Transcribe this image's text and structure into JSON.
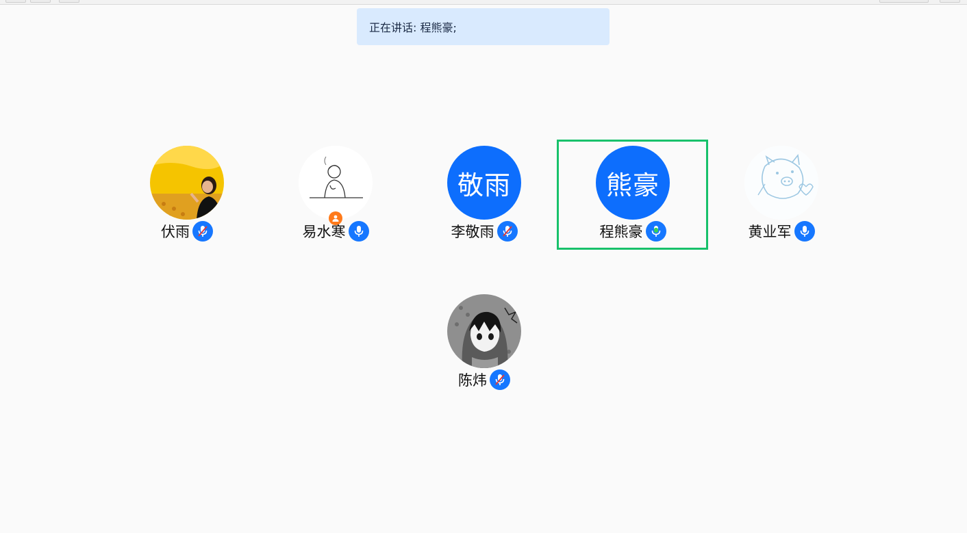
{
  "banner": {
    "label": "正在讲话:",
    "speaker": "程熊豪;"
  },
  "participants": [
    {
      "name": "伏雨",
      "avatar": "photo-yellow",
      "mic": "muted"
    },
    {
      "name": "易水寒",
      "avatar": "sketch-person",
      "mic": "on",
      "badge": "host-icon"
    },
    {
      "name": "李敬雨",
      "avatar_text": "敬雨",
      "mic": "muted"
    },
    {
      "name": "程熊豪",
      "avatar_text": "熊豪",
      "mic": "speaking",
      "active": true
    },
    {
      "name": "黄业军",
      "avatar": "pig-drawing",
      "mic": "on"
    },
    {
      "name": "陈炜",
      "avatar": "anime-hood",
      "mic": "muted"
    }
  ],
  "colors": {
    "accent": "#1677ff",
    "initials_bg": "#0d6efd",
    "banner_bg": "#d9eafe",
    "active_border": "#18c16b",
    "speaking_green": "#35d05a",
    "muted_slash": "#e03a3a",
    "host_badge": "#ff7a1a"
  }
}
